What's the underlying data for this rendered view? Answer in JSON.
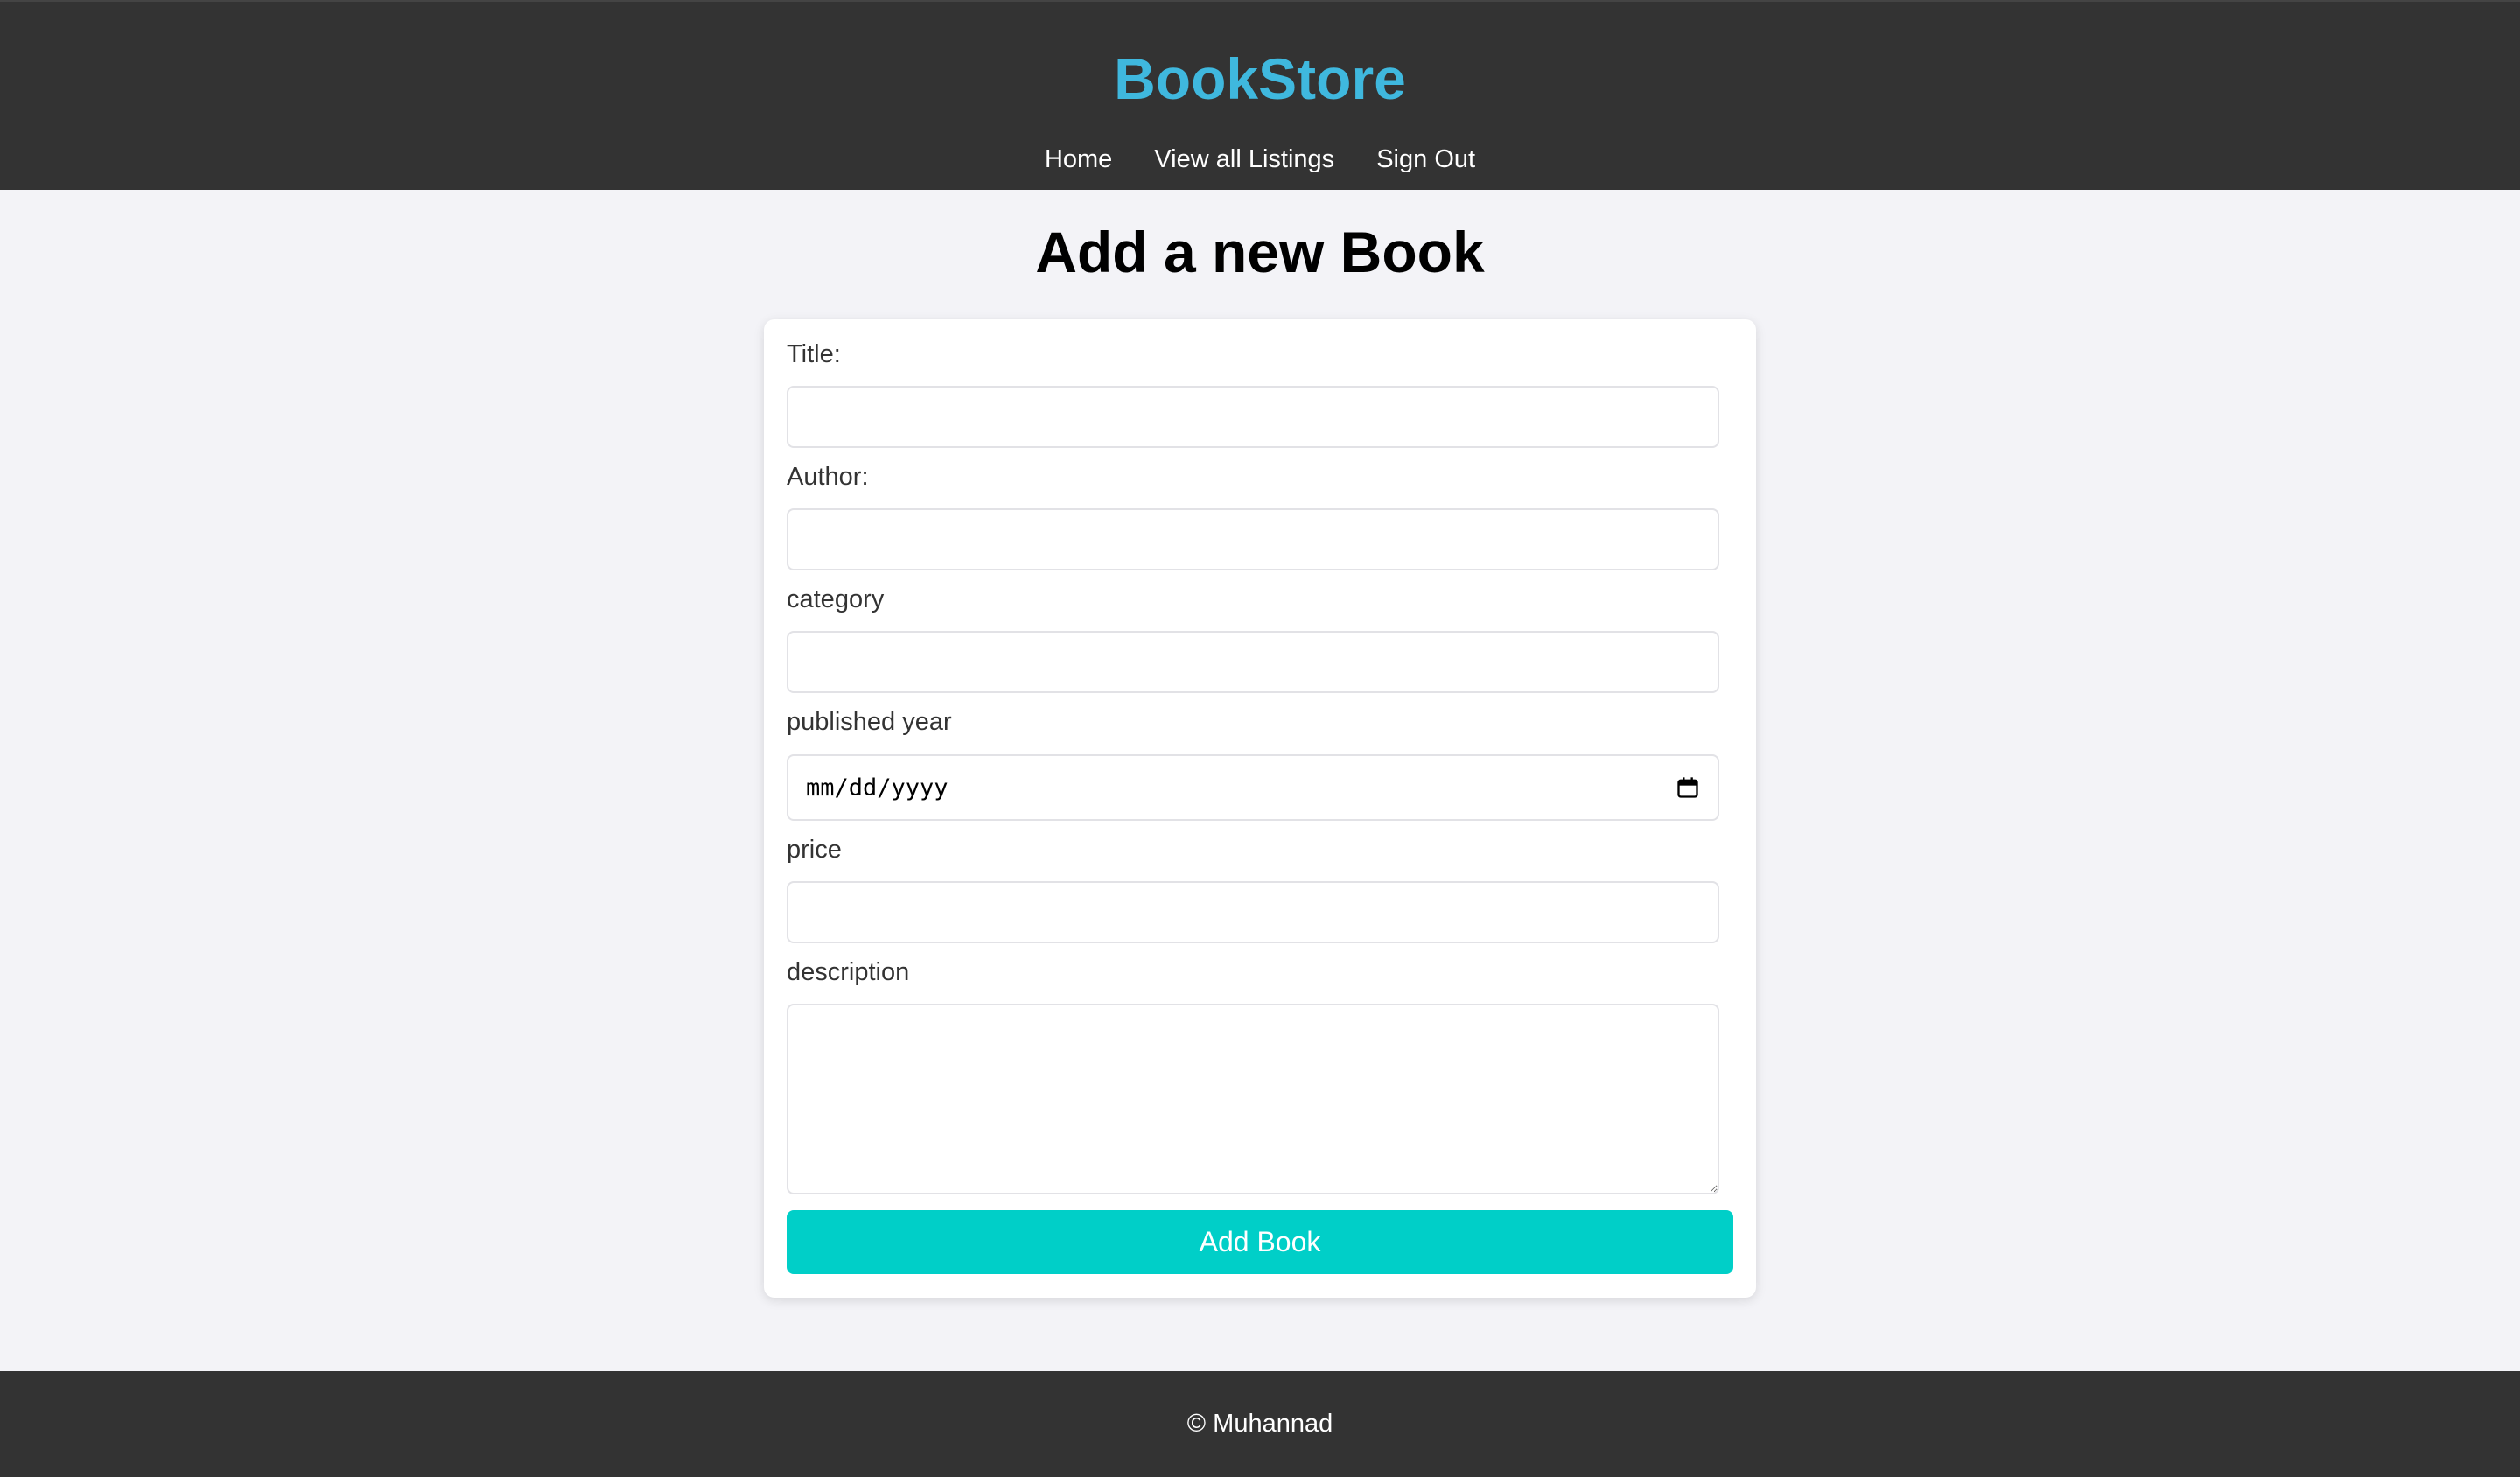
{
  "header": {
    "brand": "BookStore",
    "brand_color": "#3fb8de",
    "nav": [
      {
        "label": "Home"
      },
      {
        "label": "View all Listings"
      },
      {
        "label": "Sign Out"
      }
    ]
  },
  "main": {
    "title": "Add a new Book",
    "form": {
      "title_label": "Title:",
      "title_value": "",
      "author_label": "Author:",
      "author_value": "",
      "category_label": "category",
      "category_value": "",
      "published_label": "published year",
      "published_placeholder": "mm/dd/yyyy",
      "calendar_icon": "calendar-icon",
      "price_label": "price",
      "price_value": "",
      "description_label": "description",
      "description_value": "",
      "submit_label": "Add Book",
      "submit_color": "#00cfc8"
    }
  },
  "footer": {
    "copyright": "© Muhannad"
  }
}
